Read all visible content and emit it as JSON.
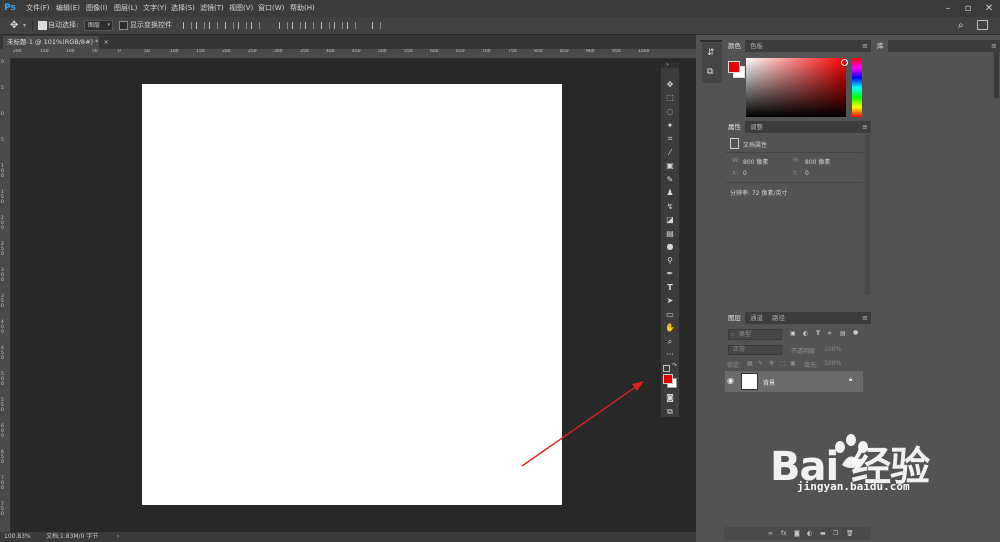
{
  "app": {
    "logo": "Ps"
  },
  "menu": [
    "文件(F)",
    "编辑(E)",
    "图像(I)",
    "图层(L)",
    "文字(Y)",
    "选择(S)",
    "滤镜(T)",
    "视图(V)",
    "窗口(W)",
    "帮助(H)"
  ],
  "options": {
    "auto_select_label": "自动选择:",
    "auto_select_value": "图层",
    "transform_label": "显示变换控件"
  },
  "document": {
    "tab_title": "未标题-1 @ 101%(RGB/8#) *"
  },
  "ruler": {
    "top": [
      "200",
      "150",
      "100",
      "50",
      "0",
      "50",
      "100",
      "150",
      "200",
      "250",
      "300",
      "350",
      "400",
      "450",
      "500",
      "550",
      "600",
      "650",
      "700",
      "750",
      "800",
      "850",
      "900",
      "950",
      "1000"
    ],
    "left": [
      "0",
      "5",
      "0",
      "5",
      "1 0 0",
      "1 5 0",
      "2 0 0",
      "2 5 0",
      "3 0 0",
      "3 5 0",
      "4 0 0",
      "4 5 0",
      "5 0 0",
      "5 5 0",
      "6 0 0",
      "6 5 0",
      "7 0 0",
      "7 5 0",
      "8 0 0"
    ]
  },
  "status": {
    "zoom": "100.83%",
    "doc_size": "文档:1.83M/0 字节",
    "arrow": "›"
  },
  "panels": {
    "color": {
      "tabs": [
        "颜色",
        "色板"
      ],
      "fg": "#e30000",
      "bg": "#ffffff"
    },
    "properties": {
      "tabs": [
        "属性",
        "调整"
      ],
      "title": "文档属性",
      "w_label": "W:",
      "w_value": "800 像素",
      "h_label": "H:",
      "h_value": "800 像素",
      "x_label": "X:",
      "x_value": "0",
      "y_label": "Y:",
      "y_value": "0",
      "resolution": "分辨率: 72 像素/英寸"
    },
    "layers": {
      "tabs": [
        "图层",
        "通道",
        "路径"
      ],
      "filter_placeholder": "类型",
      "blend_mode": "正常",
      "opacity_label": "不透明度:",
      "opacity_value": "100%",
      "lock_label": "锁定:",
      "fill_label": "填充:",
      "fill_value": "100%",
      "items": [
        {
          "name": "背景"
        }
      ]
    },
    "library": {
      "tab": "库"
    }
  },
  "watermark": {
    "logo": "Bai  经验",
    "url": "jingyan.baidu.com"
  }
}
